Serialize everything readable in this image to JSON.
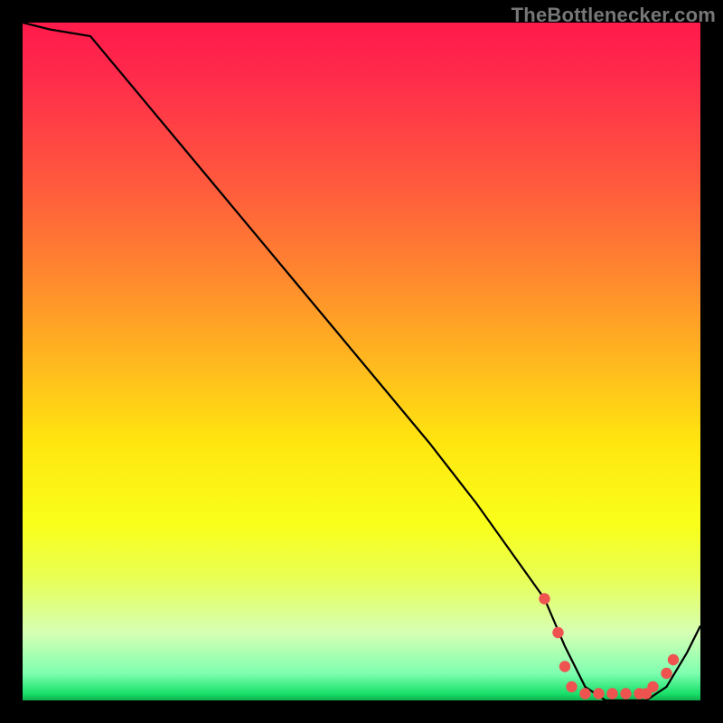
{
  "attribution": "TheBottlenecker.com",
  "chart_data": {
    "type": "line",
    "title": "",
    "xlabel": "",
    "ylabel": "",
    "xlim": [
      0,
      100
    ],
    "ylim": [
      0,
      100
    ],
    "x": [
      0,
      4,
      10,
      20,
      30,
      40,
      50,
      60,
      67,
      72,
      77,
      80,
      83,
      86,
      89,
      92,
      95,
      98,
      100
    ],
    "values": [
      100,
      99,
      98,
      86,
      74,
      62,
      50,
      38,
      29,
      22,
      15,
      8,
      2,
      0,
      0,
      0,
      2,
      7,
      11
    ],
    "markers": {
      "x": [
        77,
        79,
        80,
        81,
        83,
        85,
        87,
        89,
        91,
        92,
        93,
        95,
        96
      ],
      "y": [
        15,
        10,
        5,
        2,
        1,
        1,
        1,
        1,
        1,
        1,
        2,
        4,
        6
      ],
      "color": "#ef5350",
      "radius": 6.2
    },
    "line_color": "#000000",
    "line_width": 2.2
  }
}
